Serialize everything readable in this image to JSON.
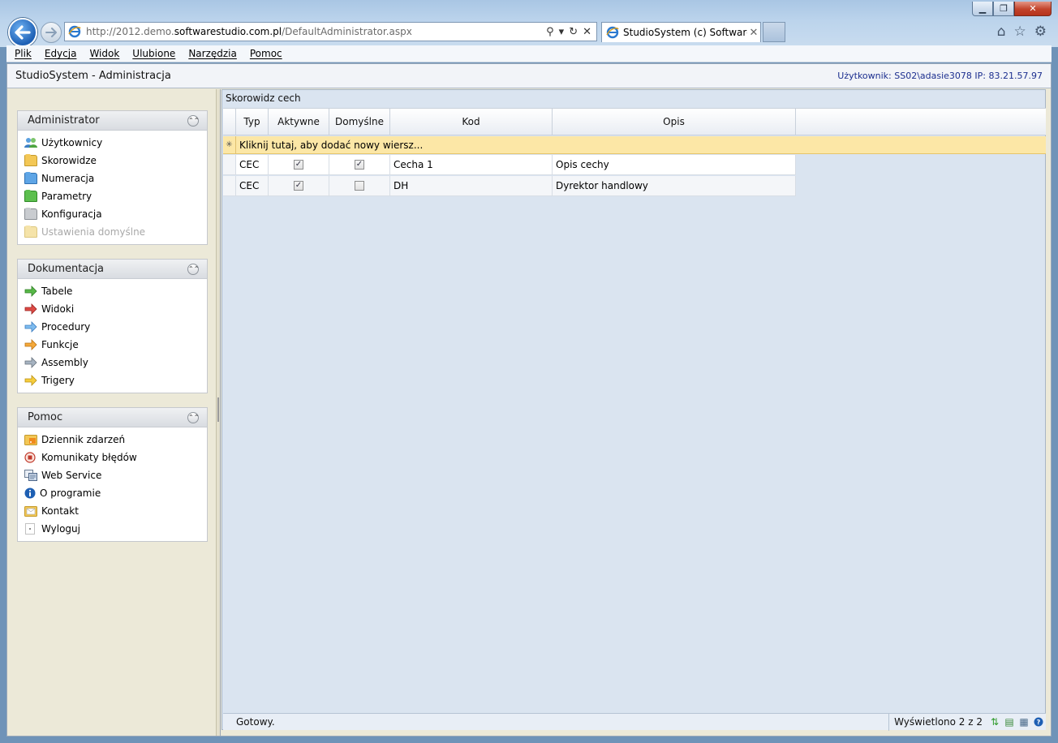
{
  "browser": {
    "url_prefix": "http://2012.demo.",
    "url_domain": "softwarestudio.com.pl",
    "url_path": "/DefaultAdministrator.aspx",
    "tab_title": "StudioSystem (c) SoftwareS...",
    "menu": [
      "Plik",
      "Edycja",
      "Widok",
      "Ulubione",
      "Narzędzia",
      "Pomoc"
    ]
  },
  "app": {
    "title": "StudioSystem - Administracja",
    "user": "Użytkownik: SS02\\adasie3078 IP: 83.21.57.97"
  },
  "sidebar": {
    "panels": [
      {
        "title": "Administrator",
        "items": [
          {
            "label": "Użytkownicy",
            "icon": "users-icon"
          },
          {
            "label": "Skorowidze",
            "icon": "folder-icon"
          },
          {
            "label": "Numeracja",
            "icon": "folder-blue-icon"
          },
          {
            "label": "Parametry",
            "icon": "folder-green-icon"
          },
          {
            "label": "Konfiguracja",
            "icon": "folder-gray-icon"
          },
          {
            "label": "Ustawienia domyślne",
            "icon": "folder-disabled-icon"
          }
        ]
      },
      {
        "title": "Dokumentacja",
        "items": [
          {
            "label": "Tabele",
            "icon": "arrow-green-icon"
          },
          {
            "label": "Widoki",
            "icon": "arrow-red-icon"
          },
          {
            "label": "Procedury",
            "icon": "arrow-blue-icon"
          },
          {
            "label": "Funkcje",
            "icon": "arrow-orange-icon"
          },
          {
            "label": "Assembly",
            "icon": "arrow-gray-icon"
          },
          {
            "label": "Trigery",
            "icon": "arrow-yellow-icon"
          }
        ]
      },
      {
        "title": "Pomoc",
        "items": [
          {
            "label": "Dziennik zdarzeń",
            "icon": "rss-folder-icon"
          },
          {
            "label": "Komunikaty błędów",
            "icon": "stop-icon"
          },
          {
            "label": "Web Service",
            "icon": "web-service-icon"
          },
          {
            "label": "O programie",
            "icon": "info-icon"
          },
          {
            "label": "Kontakt",
            "icon": "mail-folder-icon"
          },
          {
            "label": "Wyloguj",
            "icon": "logout-icon"
          }
        ]
      }
    ]
  },
  "main": {
    "title": "Skorowidz cech",
    "columns": [
      "Typ",
      "Aktywne",
      "Domyślne",
      "Kod",
      "Opis"
    ],
    "new_row_text": "Kliknij tutaj, aby dodać nowy wiersz...",
    "rows": [
      {
        "typ": "CEC",
        "aktywne": true,
        "domyslne": true,
        "kod": "Cecha 1",
        "opis": "Opis cechy"
      },
      {
        "typ": "CEC",
        "aktywne": true,
        "domyslne": false,
        "kod": "DH",
        "opis": "Dyrektor handlowy"
      }
    ],
    "status": "Gotowy.",
    "count": "Wyświetlono 2 z 2"
  },
  "colors": {
    "new_row": "#fce7a6",
    "grid_bg": "#dae4f0",
    "sidebar_bg": "#ece9d8"
  }
}
